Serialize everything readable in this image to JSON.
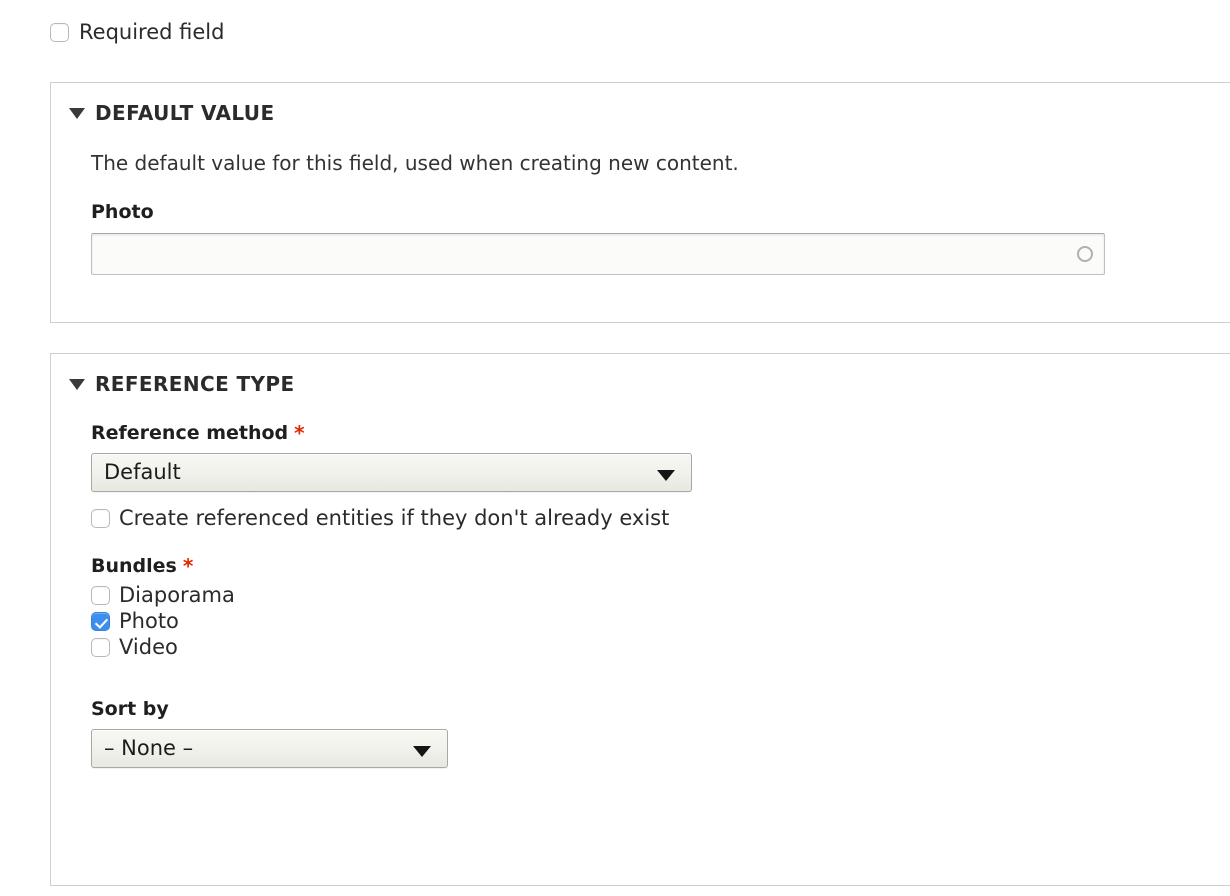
{
  "top": {
    "required_field_label": "Required field",
    "required_field_checked": false
  },
  "default_value_section": {
    "legend": "DEFAULT VALUE",
    "disclosure": "expanded",
    "description": "The default value for this field, used when creating new content.",
    "field_label": "Photo",
    "input_value": "",
    "input_placeholder": "",
    "throbber_icon": "throbber-ring-icon"
  },
  "reference_type_section": {
    "legend": "REFERENCE TYPE",
    "disclosure": "expanded",
    "reference_method": {
      "label": "Reference method",
      "required_marker": "*",
      "selected": "Default"
    },
    "create_referenced": {
      "label": "Create referenced entities if they don't already exist",
      "checked": false
    },
    "bundles": {
      "label": "Bundles",
      "required_marker": "*",
      "items": [
        {
          "label": "Diaporama",
          "checked": false
        },
        {
          "label": "Photo",
          "checked": true
        },
        {
          "label": "Video",
          "checked": false
        }
      ]
    },
    "sort_by": {
      "label": "Sort by",
      "selected": "– None –"
    }
  },
  "colors": {
    "accent_checkbox": "#3d8eee",
    "required_star": "#e62600",
    "fieldset_border": "#cfcfcf",
    "text": "#2b2b2b"
  }
}
